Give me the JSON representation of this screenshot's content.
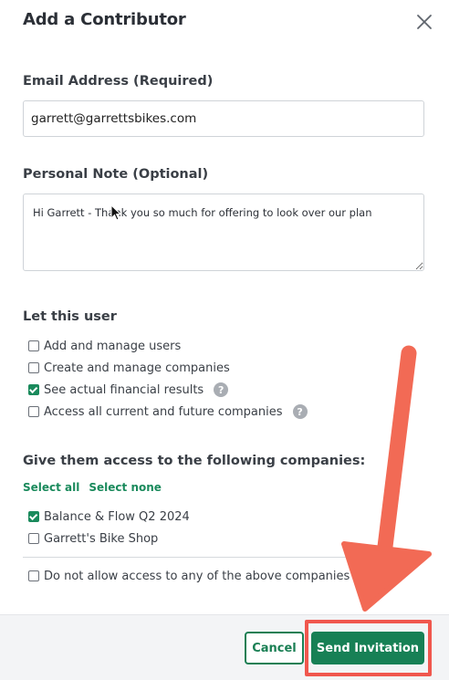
{
  "dialog": {
    "title": "Add a Contributor"
  },
  "email": {
    "label": "Email Address (Required)",
    "value": "garrett@garrettsbikes.com"
  },
  "note": {
    "label": "Personal Note (Optional)",
    "value": "Hi Garrett - Thank you so much for offering to look over our plan"
  },
  "permissions": {
    "heading": "Let this user",
    "items": [
      {
        "label": "Add and manage users",
        "checked": false,
        "help": false
      },
      {
        "label": "Create and manage companies",
        "checked": false,
        "help": false
      },
      {
        "label": "See actual financial results",
        "checked": true,
        "help": true
      },
      {
        "label": "Access all current and future companies",
        "checked": false,
        "help": true
      }
    ],
    "help_glyph": "?"
  },
  "companies": {
    "heading": "Give them access to the following companies:",
    "select_all": "Select all",
    "select_none": "Select none",
    "items": [
      {
        "label": "Balance & Flow Q2 2024",
        "checked": true
      },
      {
        "label": "Garrett's Bike Shop",
        "checked": false
      }
    ],
    "no_access_label": "Do not allow access to any of the above companies"
  },
  "footer": {
    "cancel_label": "Cancel",
    "send_label": "Send Invitation"
  },
  "colors": {
    "accent": "#178055",
    "annotation": "#f0574e"
  },
  "icons": {
    "close": "close-icon",
    "help": "help-icon",
    "cursor": "mouse-pointer-icon",
    "annotation_arrow": "red-arrow-annotation"
  }
}
